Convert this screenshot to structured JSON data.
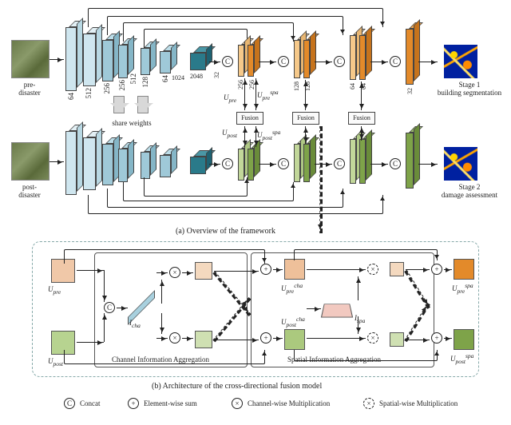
{
  "inputs": {
    "pre": "pre-\ndisaster",
    "post": "post-\ndisaster"
  },
  "outputs": {
    "stage1": "Stage 1\nbuilding segmentation",
    "stage2": "Stage 2\ndamage assessment"
  },
  "encoder_dims": [
    "64",
    "512",
    "256",
    "256",
    "512",
    "128",
    "64",
    "1024",
    "2048",
    "32"
  ],
  "decoder_dims": [
    "256",
    "256",
    "128",
    "128",
    "64",
    "64",
    "32"
  ],
  "share_weights": "share weights",
  "fusion_label": "Fusion",
  "features": {
    "Upre": "U",
    "Upre_sub": "pre",
    "Upost": "U",
    "Upost_sub": "post",
    "Upre_spa": "U",
    "Upre_spa_sub": "pre",
    "Upre_spa_sup": "spa",
    "Upost_spa": "U",
    "Upost_spa_sub": "post",
    "Upost_spa_sup": "spa",
    "Upre_cha": "U",
    "Upre_cha_sub": "pre",
    "Upre_cha_sup": "cha",
    "Upost_cha": "U",
    "Upost_cha_sub": "post",
    "Upost_cha_sup": "cha",
    "Icha": "I",
    "Icha_sub": "cha",
    "Ispa": "I",
    "Ispa_sub": "spa"
  },
  "subcaptions": {
    "a": "(a) Overview of the framework",
    "b": "(b) Architecture of the cross-directional fusion model"
  },
  "legend": {
    "concat": "Concat",
    "concat_sym": "C",
    "elemsum": "Element-wise sum",
    "elemsum_sym": "+",
    "chanmul": "Channel-wise Multiplication",
    "chanmul_sym": "×",
    "spatmul": "Spatial-wise Multiplication",
    "spatmul_sym": "×"
  },
  "panels": {
    "cha": "Channel Information Aggregation",
    "spa": "Spatial Information Aggregation"
  },
  "chart_data": {
    "type": "diagram",
    "note": "Architecture figure; no quantitative chart data.",
    "encoder_channel_sequence": [
      64,
      512,
      256,
      256,
      512,
      128,
      64,
      1024,
      2048,
      32
    ],
    "decoder_channel_sequence": [
      256,
      256,
      128,
      128,
      64,
      64,
      32
    ]
  }
}
